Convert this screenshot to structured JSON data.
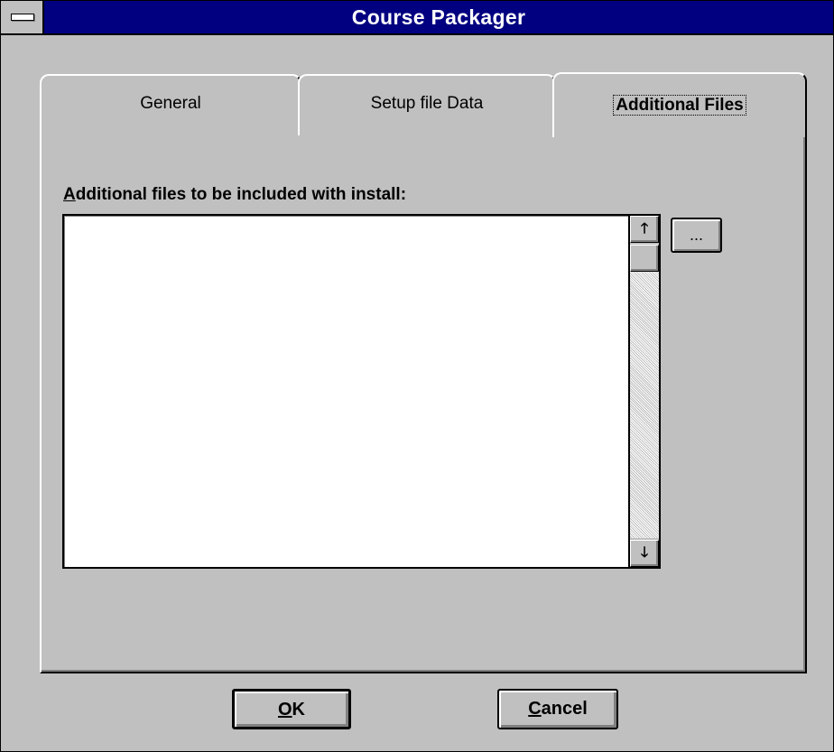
{
  "window": {
    "title": "Course Packager"
  },
  "tabs": [
    {
      "label": "General",
      "active": false
    },
    {
      "label": "Setup file Data",
      "active": false
    },
    {
      "label": "Additional Files",
      "active": true
    }
  ],
  "additional_files": {
    "label_mnemonic": "A",
    "label_rest": "dditional files to be included with install:",
    "items": [],
    "browse_label": "...",
    "scroll_up_glyph": "🡑",
    "scroll_down_glyph": "🡓"
  },
  "buttons": {
    "ok_mnemonic": "O",
    "ok_rest": "K",
    "cancel_mnemonic": "C",
    "cancel_rest": "ancel"
  }
}
